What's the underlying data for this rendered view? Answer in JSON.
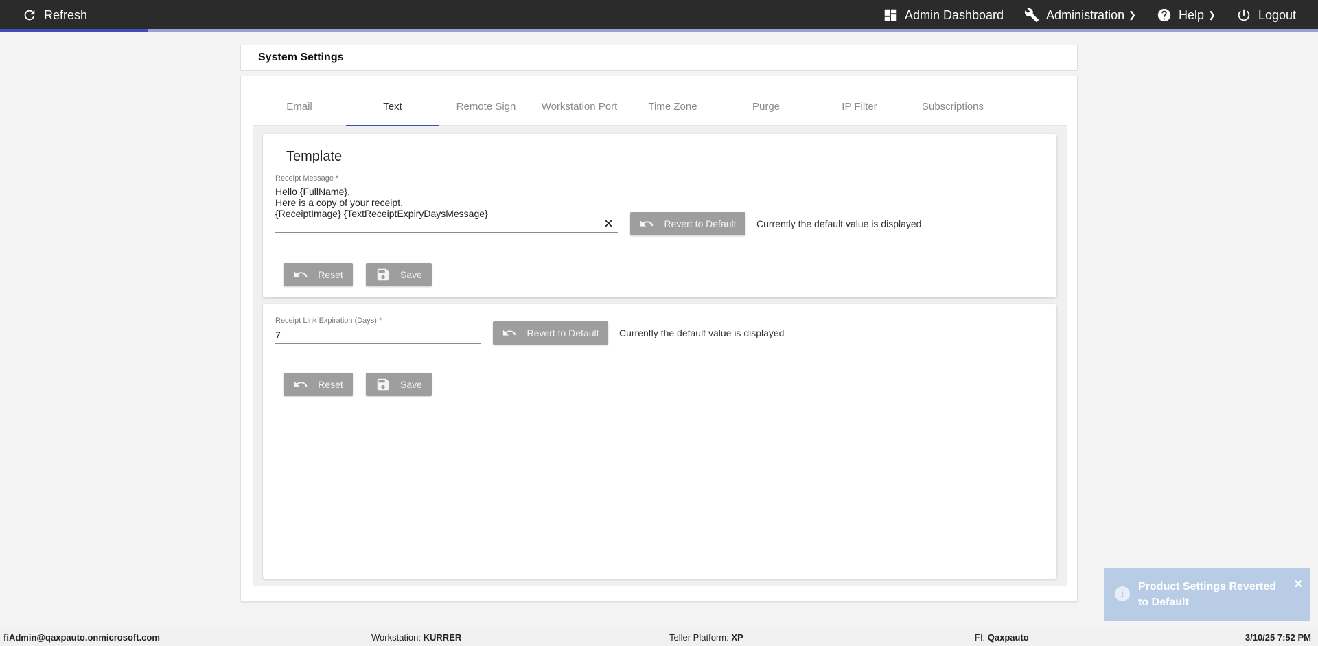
{
  "topbar": {
    "refresh": "Refresh",
    "admin_dashboard": "Admin Dashboard",
    "administration": "Administration",
    "help": "Help",
    "logout": "Logout"
  },
  "header": {
    "title": "System Settings"
  },
  "tabs": [
    {
      "label": "Email"
    },
    {
      "label": "Text",
      "active": true
    },
    {
      "label": "Remote Sign"
    },
    {
      "label": "Workstation Port"
    },
    {
      "label": "Time Zone"
    },
    {
      "label": "Purge"
    },
    {
      "label": "IP Filter"
    },
    {
      "label": "Subscriptions"
    }
  ],
  "template_panel": {
    "title": "Template",
    "receipt_message_label": "Receipt Message *",
    "receipt_message_value": "Hello {FullName},\nHere is a copy of your receipt.\n{ReceiptImage} {TextReceiptExpiryDaysMessage}",
    "clear": "✕",
    "revert": "Revert to Default",
    "default_note": "Currently the default value is displayed",
    "reset": "Reset",
    "save": "Save"
  },
  "expiration_panel": {
    "label": "Receipt Link Expiration (Days) *",
    "value": "7",
    "revert": "Revert to Default",
    "default_note": "Currently the default value is displayed",
    "reset": "Reset",
    "save": "Save"
  },
  "toast": {
    "message": "Product Settings Reverted to Default",
    "close": "✕",
    "info": "i"
  },
  "footer": {
    "user": "fiAdmin@qaxpauto.onmicrosoft.com",
    "workstation_label": "Workstation:",
    "workstation_value": "KURRER",
    "teller_label": "Teller Platform:",
    "teller_value": "XP",
    "fi_label": "FI:",
    "fi_value": "Qaxpauto",
    "datetime": "3/10/25 7:52 PM"
  },
  "colors": {
    "topbar": "#2b2b2b",
    "accent": "#3f4fb8",
    "button_gray": "#9e9e9e",
    "toast": "#b8cce6"
  }
}
